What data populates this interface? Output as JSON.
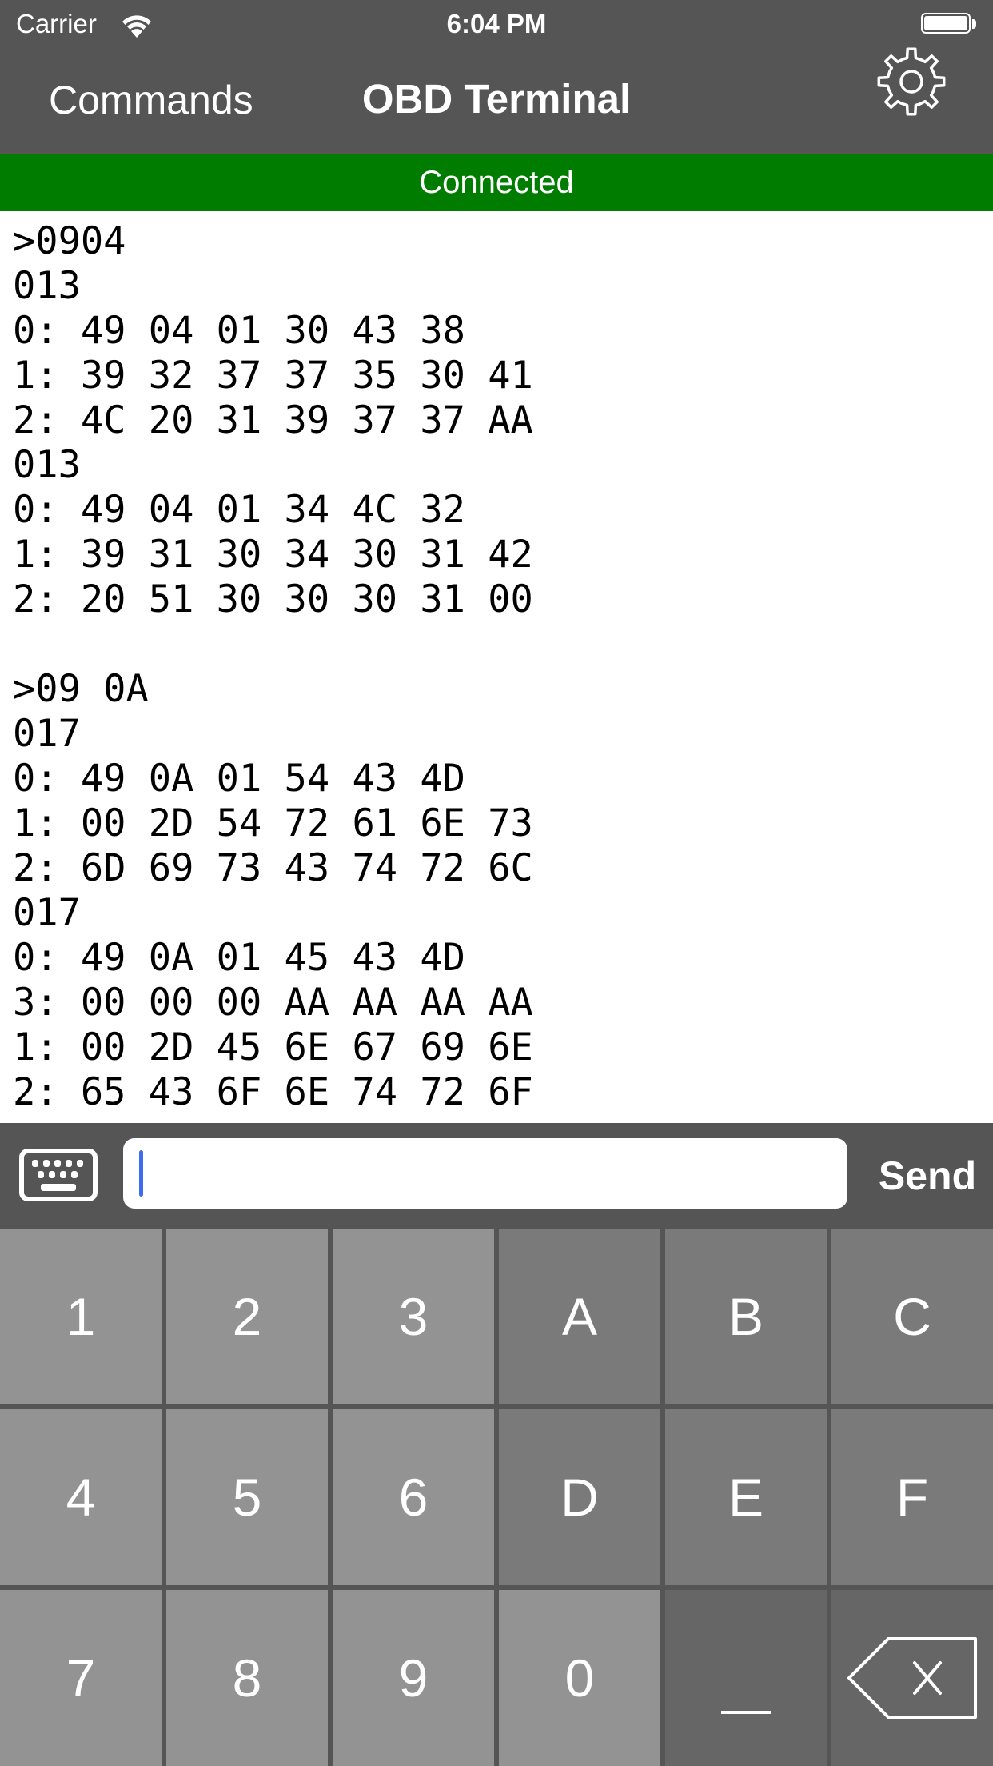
{
  "status_bar": {
    "carrier": "Carrier",
    "time": "6:04 PM",
    "wifi_icon": "wifi-icon",
    "battery_icon": "battery-icon",
    "battery_level": 1.0
  },
  "nav": {
    "left_button": "Commands",
    "title": "OBD Terminal",
    "right_icon": "gear-icon"
  },
  "connection": {
    "status": "Connected",
    "color": "#007d00"
  },
  "terminal": {
    "lines": [
      ">0904",
      "013",
      "0: 49 04 01 30 43 38",
      "1: 39 32 37 37 35 30 41",
      "2: 4C 20 31 39 37 37 AA",
      "013",
      "0: 49 04 01 34 4C 32",
      "1: 39 31 30 34 30 31 42",
      "2: 20 51 30 30 30 31 00",
      "",
      ">09 0A",
      "017",
      "0: 49 0A 01 54 43 4D",
      "1: 00 2D 54 72 61 6E 73",
      "2: 6D 69 73 43 74 72 6C",
      "017",
      "0: 49 0A 01 45 43 4D",
      "3: 00 00 00 AA AA AA AA",
      "1: 00 2D 45 6E 67 69 6E",
      "2: 65 43 6F 6E 74 72 6F"
    ]
  },
  "input_bar": {
    "keyboard_icon": "keyboard-icon",
    "input_value": "",
    "input_placeholder": "",
    "send_label": "Send"
  },
  "keypad": {
    "keys": [
      {
        "label": "1",
        "shade": "light"
      },
      {
        "label": "2",
        "shade": "light"
      },
      {
        "label": "3",
        "shade": "light"
      },
      {
        "label": "A",
        "shade": "mid"
      },
      {
        "label": "B",
        "shade": "mid"
      },
      {
        "label": "C",
        "shade": "mid"
      },
      {
        "label": "4",
        "shade": "light"
      },
      {
        "label": "5",
        "shade": "light"
      },
      {
        "label": "6",
        "shade": "light"
      },
      {
        "label": "D",
        "shade": "mid"
      },
      {
        "label": "E",
        "shade": "mid"
      },
      {
        "label": "F",
        "shade": "mid"
      },
      {
        "label": "7",
        "shade": "light"
      },
      {
        "label": "8",
        "shade": "light"
      },
      {
        "label": "9",
        "shade": "light"
      },
      {
        "label": "0",
        "shade": "light"
      },
      {
        "label": "_",
        "shade": "dark"
      },
      {
        "label": "",
        "shade": "dark",
        "icon": "backspace-icon"
      }
    ]
  }
}
